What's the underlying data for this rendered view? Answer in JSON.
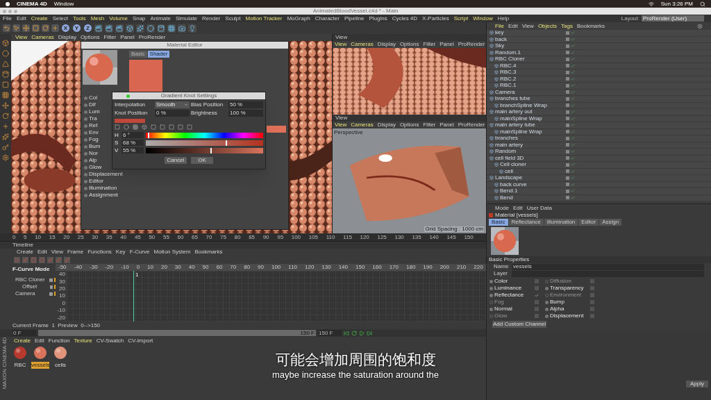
{
  "menubar": {
    "app": "CINEMA 4D",
    "menu": "Window",
    "clock": "Sun 3:26 PM"
  },
  "window": {
    "title": "AnimatedBloodVessel.c4d * - Main"
  },
  "menu": [
    "File",
    "Edit",
    "Create",
    "Select",
    "Tools",
    "Mesh",
    "Volume",
    "Snap",
    "Animate",
    "Simulate",
    "Render",
    "Sculpt",
    "Motion Tracker",
    "MoGraph",
    "Character",
    "Pipeline",
    "Plugins",
    "Cycles 4D",
    "X-Particles",
    "Script",
    "Window",
    "Help"
  ],
  "axis_buttons": [
    "X",
    "Y",
    "Z"
  ],
  "layout": {
    "label": "Layout:",
    "value": "ProRender (User)"
  },
  "viewport": {
    "menu": [
      "View",
      "Cameras",
      "Display",
      "Options",
      "Filter",
      "Panel",
      "ProRender"
    ]
  },
  "material_editor": {
    "title": "Material Editor",
    "tabs": [
      {
        "label": "Basic",
        "selected": false
      },
      {
        "label": "Shader",
        "selected": true
      }
    ],
    "channels": [
      "Col",
      "Dif",
      "Lum",
      "Tra",
      "Ref",
      "Env",
      "Fog",
      "Bum",
      "Nor",
      "Alp",
      "Glow",
      "Displacement",
      "Editor",
      "Illumination",
      "Assignment"
    ]
  },
  "gradient_knot": {
    "title": "Gradient Knot Settings",
    "interpolation_label": "Interpolation",
    "interpolation": "Smooth",
    "bias_label": "Bias Position",
    "bias": "50 %",
    "knot_label": "Knot Position",
    "knot": "0 %",
    "brightness_label": "Brightness",
    "brightness": "100 %",
    "hsv": [
      {
        "label": "H",
        "value": "6 °",
        "kind": "hue",
        "level": 0.02
      },
      {
        "label": "S",
        "value": "68 %",
        "kind": "saturation",
        "level": 0.68
      },
      {
        "label": "V",
        "value": "55 %",
        "kind": "value",
        "level": 0.55
      }
    ],
    "buttons": [
      "Cancel",
      "OK"
    ]
  },
  "views": [
    {
      "title": "View",
      "menu": [
        "View",
        "Cameras",
        "Display",
        "Options",
        "Filter",
        "Panel",
        "ProRender"
      ]
    },
    {
      "title": "View",
      "menu": [
        "View",
        "Cameras",
        "Display",
        "Options",
        "Filter",
        "Panel",
        "ProRender"
      ],
      "camera": "Perspective",
      "grid": "Grid Spacing : 1000 cm"
    }
  ],
  "frame_ruler": [
    "0",
    "5",
    "10",
    "15",
    "20",
    "25",
    "30",
    "35",
    "40",
    "45",
    "50",
    "55",
    "60",
    "65",
    "70",
    "75",
    "80",
    "85",
    "90",
    "95",
    "100",
    "105",
    "110",
    "115",
    "120",
    "125",
    "130",
    "135",
    "140",
    "145",
    "150"
  ],
  "objects": {
    "menu": [
      "File",
      "Edit",
      "View",
      "Objects",
      "Tags",
      "Bookmarks"
    ],
    "items": [
      {
        "name": "key"
      },
      {
        "name": "back"
      },
      {
        "name": "Sky"
      },
      {
        "name": "Random.1"
      },
      {
        "name": "RBC Cloner",
        "children": [
          {
            "name": "RBC.4"
          },
          {
            "name": "RBC.3"
          },
          {
            "name": "RBC.2"
          },
          {
            "name": "RBC.1"
          }
        ]
      },
      {
        "name": "Camera"
      },
      {
        "name": "branches tube",
        "children": [
          {
            "name": "branchSpline Wrap"
          }
        ]
      },
      {
        "name": "main artery out",
        "children": [
          {
            "name": "mainSpline Wrap"
          }
        ]
      },
      {
        "name": "main artery tube",
        "children": [
          {
            "name": "mainSpline Wrap"
          }
        ]
      },
      {
        "name": "branches"
      },
      {
        "name": "main artery"
      },
      {
        "name": "Random"
      },
      {
        "name": "cell field 3D",
        "children": [
          {
            "name": "Cell cloner",
            "children": [
              {
                "name": "cell"
              }
            ]
          }
        ]
      },
      {
        "name": "Landscape",
        "children": [
          {
            "name": "back curve"
          },
          {
            "name": "Bend.1"
          },
          {
            "name": "Bend"
          }
        ]
      }
    ]
  },
  "attributes": {
    "menu": [
      "Mode",
      "Edit",
      "User Data"
    ],
    "title": "Material [vessels]",
    "tabs": [
      {
        "label": "Basic",
        "selected": true
      },
      {
        "label": "Reflectance",
        "selected": false
      },
      {
        "label": "Illumination",
        "selected": false
      },
      {
        "label": "Editor",
        "selected": false
      },
      {
        "label": "Assign",
        "selected": false
      }
    ],
    "section": "Basic Properties",
    "name_label": "Name",
    "name": "vessels",
    "layer_label": "Layer",
    "channels": [
      {
        "label": "Color",
        "checked": false,
        "disabled": false
      },
      {
        "label": "Diffusion",
        "checked": false,
        "disabled": true
      },
      {
        "label": "Luminance",
        "checked": false,
        "disabled": false
      },
      {
        "label": "Transparency",
        "checked": false,
        "disabled": false
      },
      {
        "label": "Reflectance",
        "checked": true,
        "disabled": false
      },
      {
        "label": "Environment",
        "checked": false,
        "disabled": true
      },
      {
        "label": "Fog",
        "checked": false,
        "disabled": true
      },
      {
        "label": "Bump",
        "checked": false,
        "disabled": false
      },
      {
        "label": "Normal",
        "checked": false,
        "disabled": false
      },
      {
        "label": "Alpha",
        "checked": false,
        "disabled": false
      },
      {
        "label": "Glow",
        "checked": false,
        "disabled": true
      },
      {
        "label": "Displacement",
        "checked": false,
        "disabled": false
      }
    ],
    "button": "Add Custom Channel"
  },
  "timeline": {
    "title": "Timeline",
    "menu": [
      "Create",
      "Edit",
      "View",
      "Frame",
      "Functions",
      "Key",
      "F-Curve",
      "Motion System",
      "Bookmarks"
    ],
    "mode": "F-Curve Mode",
    "tracks": [
      {
        "label": "RBC Cloner",
        "children": [
          {
            "label": "Offset"
          }
        ]
      },
      {
        "label": "Camera"
      }
    ],
    "x_ticks": [
      "-50",
      "-40",
      "-30",
      "-20",
      "-10",
      "0",
      "10",
      "20",
      "30",
      "40",
      "50",
      "60",
      "70",
      "80",
      "90",
      "100",
      "110",
      "120",
      "130",
      "140",
      "150",
      "160",
      "170",
      "180",
      "190",
      "200",
      "210",
      "220"
    ],
    "playhead": "1",
    "y_ticks": [
      "40",
      "30",
      "20",
      "10",
      "0",
      "-10",
      "-20"
    ],
    "status": "Current Frame  1  Preview  0-->150",
    "start": "0 F",
    "end_inner": "150 F",
    "end": "150 F"
  },
  "materials": {
    "menu": [
      "Create",
      "Edit",
      "Function",
      "Texture",
      "CV-Swatch",
      "CV-Import"
    ],
    "items": [
      {
        "name": "RBC",
        "selected": false,
        "color": "#b83a2e"
      },
      {
        "name": "vessels",
        "selected": true,
        "color": "#d9735c"
      },
      {
        "name": "cells",
        "selected": false,
        "color": "#e0957a"
      }
    ],
    "logo": "MAXON CINEMA 4D"
  },
  "apply": "Apply",
  "subtitle": {
    "zh": "可能会增加周围的饱和度",
    "en": "maybe increase the saturation around the"
  }
}
